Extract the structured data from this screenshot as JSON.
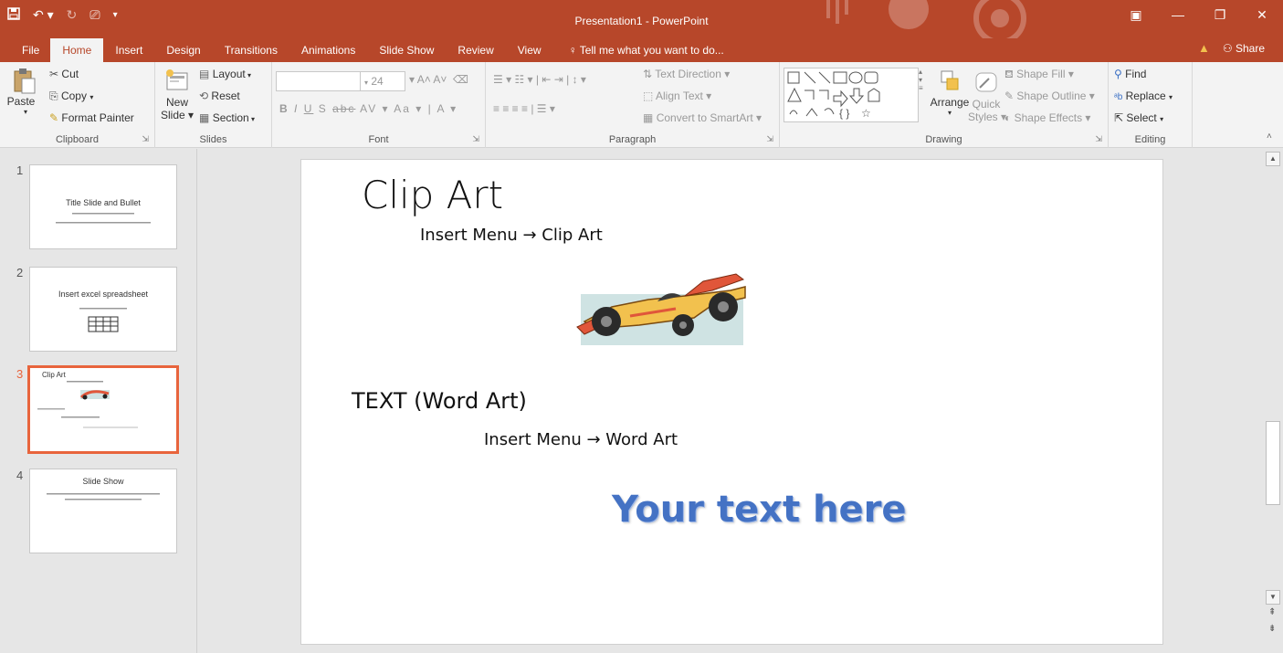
{
  "window": {
    "title": "Presentation1 - PowerPoint"
  },
  "tabs": [
    "File",
    "Home",
    "Insert",
    "Design",
    "Transitions",
    "Animations",
    "Slide Show",
    "Review",
    "View"
  ],
  "tellme": "Tell me what you want to do...",
  "share": "Share",
  "ribbon": {
    "clipboard": {
      "label": "Clipboard",
      "paste": "Paste",
      "cut": "Cut",
      "copy": "Copy",
      "format_painter": "Format Painter"
    },
    "slides": {
      "label": "Slides",
      "new_slide": "New",
      "new_slide2": "Slide",
      "layout": "Layout",
      "reset": "Reset",
      "section": "Section"
    },
    "font": {
      "label": "Font",
      "size": "24"
    },
    "paragraph": {
      "label": "Paragraph",
      "text_direction": "Text Direction",
      "align_text": "Align Text",
      "smartart": "Convert to SmartArt"
    },
    "drawing": {
      "label": "Drawing",
      "arrange": "Arrange",
      "quick": "Quick",
      "styles": "Styles",
      "shape_fill": "Shape Fill",
      "shape_outline": "Shape Outline",
      "shape_effects": "Shape Effects"
    },
    "editing": {
      "label": "Editing",
      "find": "Find",
      "replace": "Replace",
      "select": "Select"
    }
  },
  "thumbnails": [
    {
      "num": "1",
      "title": "Title Slide and Bullet"
    },
    {
      "num": "2",
      "title": "Insert excel spreadsheet"
    },
    {
      "num": "3",
      "title": "Clip Art"
    },
    {
      "num": "4",
      "title": "Slide Show"
    }
  ],
  "slide": {
    "title": "Clip Art",
    "line1": "Insert Menu → Clip Art",
    "heading2": "TEXT (Word Art)",
    "line2": "Insert Menu → Word Art",
    "wordart": "Your text here"
  },
  "colors": {
    "brand": "#b7472a",
    "selection": "#e8643c",
    "wordart": "#4472c4"
  }
}
